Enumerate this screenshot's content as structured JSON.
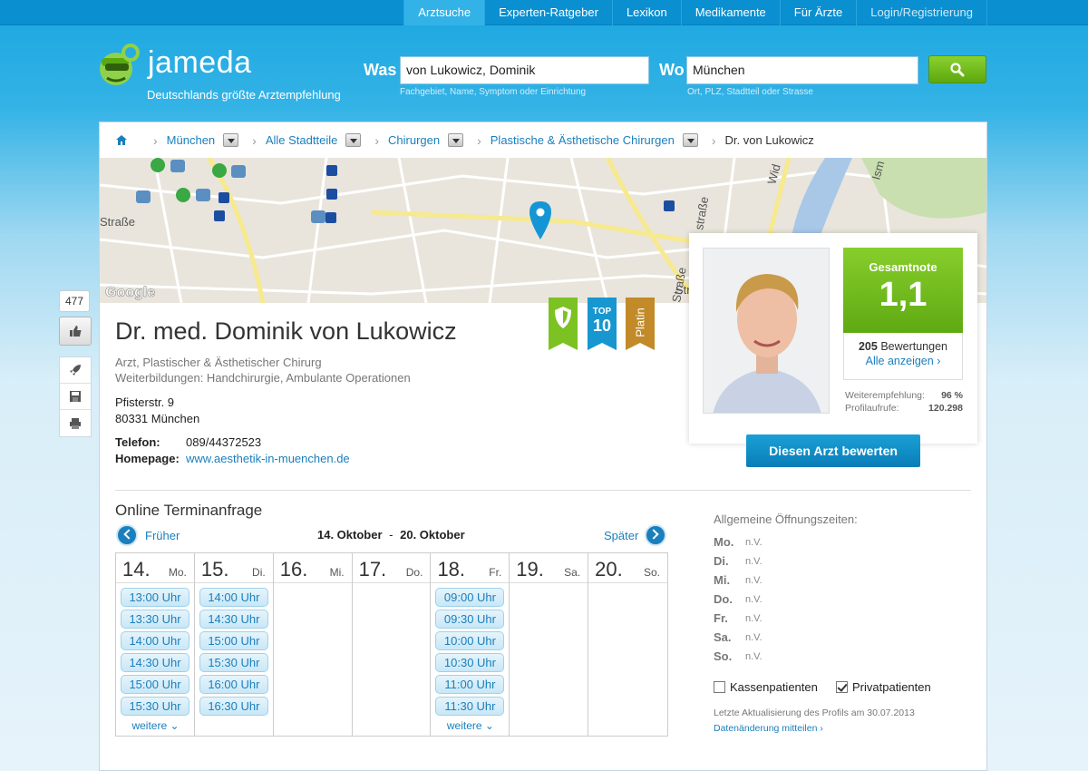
{
  "topnav": {
    "items": [
      "Arztsuche",
      "Experten-Ratgeber",
      "Lexikon",
      "Medikamente",
      "Für Ärzte",
      "Login/Registrierung"
    ]
  },
  "logo": {
    "word": "jameda",
    "tagline": "Deutschlands größte Arztempfehlung"
  },
  "search": {
    "was_label": "Was",
    "was_value": "von Lukowicz, Dominik",
    "was_hint": "Fachgebiet, Name, Symptom oder Einrichtung",
    "wo_label": "Wo",
    "wo_value": "München",
    "wo_hint": "Ort, PLZ, Stadtteil oder Strasse"
  },
  "breadcrumb": [
    "München",
    "Alle Stadtteile",
    "Chirurgen",
    "Plastische & Ästhetische Chirurgen",
    "Dr. von Lukowicz"
  ],
  "map": {
    "attribution": "Google",
    "street_labels": [
      "Straße",
      "straße",
      "Straße",
      "Wid",
      "Ism",
      "Str"
    ]
  },
  "doctor": {
    "name": "Dr. med. Dominik von Lukowicz",
    "specialty": "Arzt, Plastischer & Ästhetischer Chirurg",
    "training": "Weiterbildungen: Handchirurgie, Ambulante Operationen",
    "street": "Pfisterstr. 9",
    "city": "80331 München",
    "phone_label": "Telefon:",
    "phone": "089/44372523",
    "homepage_label": "Homepage:",
    "homepage": "www.aesthetik-in-muenchen.de"
  },
  "badges": {
    "top_line1": "TOP",
    "top_line2": "10",
    "platin": "Platin"
  },
  "rating": {
    "title": "Gesamtnote",
    "grade": "1,1",
    "count": "205",
    "count_label": "Bewertungen",
    "show_all": "Alle anzeigen",
    "recommend_label": "Weiterempfehlung:",
    "recommend": "96 %",
    "views_label": "Profilaufrufe:",
    "views": "120.298",
    "rate_button": "Diesen Arzt bewerten"
  },
  "appointments": {
    "title": "Online Terminanfrage",
    "earlier": "Früher",
    "later": "Später",
    "range_from": "14. Oktober",
    "range_sep": "-",
    "range_to": "20. Oktober",
    "more": "weitere",
    "days": [
      {
        "num": "14.",
        "dow": "Mo.",
        "slots": [
          "13:00 Uhr",
          "13:30 Uhr",
          "14:00 Uhr",
          "14:30 Uhr",
          "15:00 Uhr",
          "15:30 Uhr"
        ],
        "more": true
      },
      {
        "num": "15.",
        "dow": "Di.",
        "slots": [
          "14:00 Uhr",
          "14:30 Uhr",
          "15:00 Uhr",
          "15:30 Uhr",
          "16:00 Uhr",
          "16:30 Uhr"
        ],
        "more": false
      },
      {
        "num": "16.",
        "dow": "Mi.",
        "slots": [],
        "more": false
      },
      {
        "num": "17.",
        "dow": "Do.",
        "slots": [],
        "more": false
      },
      {
        "num": "18.",
        "dow": "Fr.",
        "slots": [
          "09:00 Uhr",
          "09:30 Uhr",
          "10:00 Uhr",
          "10:30 Uhr",
          "11:00 Uhr",
          "11:30 Uhr"
        ],
        "more": true
      },
      {
        "num": "19.",
        "dow": "Sa.",
        "slots": [],
        "more": false
      },
      {
        "num": "20.",
        "dow": "So.",
        "slots": [],
        "more": false
      }
    ]
  },
  "hours": {
    "title": "Allgemeine Öffnungszeiten:",
    "rows": [
      {
        "day": "Mo.",
        "value": "n.V."
      },
      {
        "day": "Di.",
        "value": "n.V."
      },
      {
        "day": "Mi.",
        "value": "n.V."
      },
      {
        "day": "Do.",
        "value": "n.V."
      },
      {
        "day": "Fr.",
        "value": "n.V."
      },
      {
        "day": "Sa.",
        "value": "n.V."
      },
      {
        "day": "So.",
        "value": "n.V."
      }
    ],
    "kassen": "Kassenpatienten",
    "kassen_checked": false,
    "privat": "Privatpatienten",
    "privat_checked": true,
    "updated": "Letzte Aktualisierung des Profils am 30.07.2013",
    "report": "Datenänderung mitteilen"
  },
  "social": {
    "like_count": "477"
  },
  "colors": {
    "brand_blue": "#0a8fd0",
    "link": "#1a7fbd",
    "green": "#6cbb1c"
  }
}
